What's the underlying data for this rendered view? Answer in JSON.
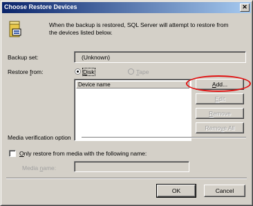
{
  "window": {
    "title": "Choose Restore Devices",
    "close_glyph": "✕"
  },
  "intro": {
    "icon": "backup-device-icon",
    "text": "When the backup is restored, SQL Server will attempt to restore from the devices listed below."
  },
  "backup_set": {
    "label": "Backup set:",
    "value": "(Unknown)"
  },
  "restore_from": {
    "label_prefix": "Restore ",
    "label_accel": "f",
    "label_suffix": "rom:",
    "options": [
      {
        "accel": "D",
        "rest": "isk",
        "selected": true,
        "enabled": true
      },
      {
        "accel": "T",
        "rest": "ape",
        "selected": false,
        "enabled": false
      }
    ]
  },
  "device_list": {
    "column_header": "Device name",
    "items": []
  },
  "buttons": {
    "add": {
      "accel": "A",
      "rest": "dd..."
    },
    "edit": {
      "accel": "E",
      "rest": "dit"
    },
    "remove": {
      "accel": "R",
      "rest": "emove"
    },
    "remove_all": {
      "prefix": "Remo",
      "accel": "v",
      "suffix": "e All"
    }
  },
  "media_verification": {
    "group_label": "Media verification option",
    "checkbox_accel": "O",
    "checkbox_rest": "nly restore from media with the following name:",
    "checked": false,
    "name_label_prefix": "Media ",
    "name_label_accel": "n",
    "name_label_suffix": "ame:",
    "name_value": ""
  },
  "footer": {
    "ok": "OK",
    "cancel": "Cancel"
  },
  "colors": {
    "dialog_bg": "#d4d0c8",
    "title_gradient_start": "#0a246a",
    "title_gradient_end": "#a6caf0",
    "annotation_red": "#e01010"
  }
}
